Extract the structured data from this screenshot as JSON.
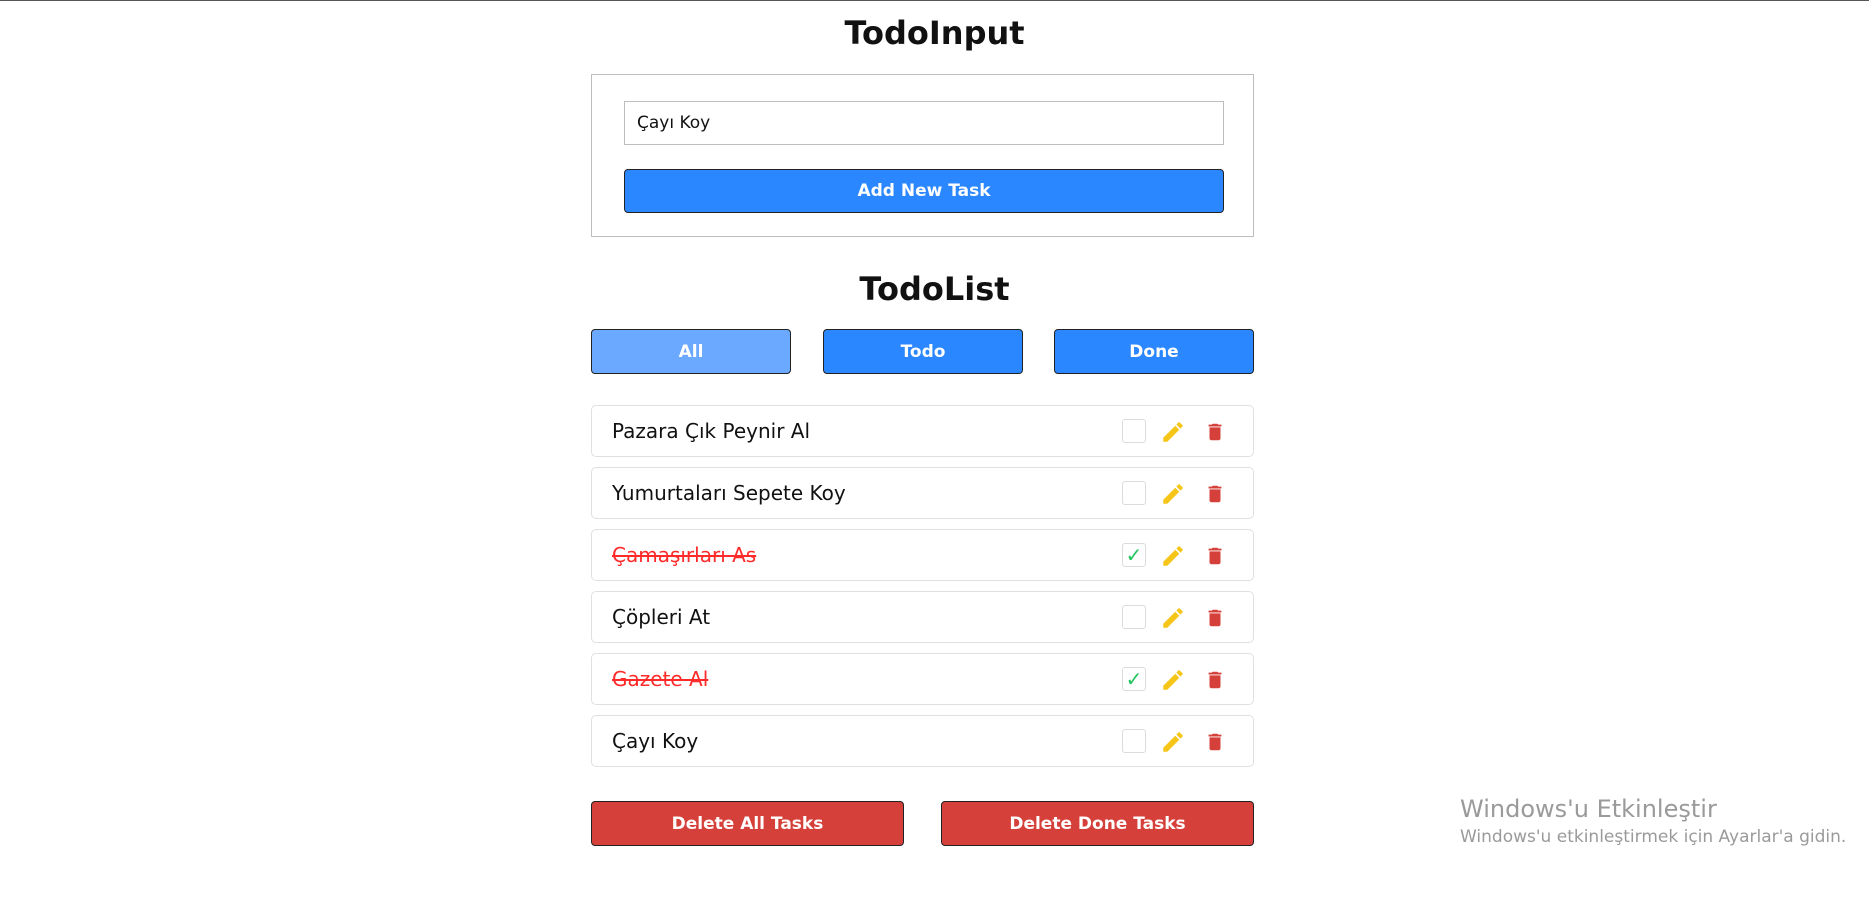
{
  "input_section": {
    "title": "TodoInput",
    "input_value": "Çayı Koy",
    "add_button_label": "Add New Task"
  },
  "list_section": {
    "title": "TodoList",
    "filters": [
      {
        "label": "All",
        "active": true
      },
      {
        "label": "Todo",
        "active": false
      },
      {
        "label": "Done",
        "active": false
      }
    ],
    "tasks": [
      {
        "text": "Pazara Çık Peynir Al",
        "done": false
      },
      {
        "text": "Yumurtaları Sepete Koy",
        "done": false
      },
      {
        "text": "Çamaşırları As",
        "done": true
      },
      {
        "text": "Çöpleri At",
        "done": false
      },
      {
        "text": "Gazete Al",
        "done": true
      },
      {
        "text": "Çayı Koy",
        "done": false
      }
    ],
    "delete_all_label": "Delete All Tasks",
    "delete_done_label": "Delete Done Tasks"
  },
  "icons": {
    "edit": "pencil-icon",
    "delete": "trash-icon",
    "check": "checkmark-icon"
  },
  "colors": {
    "primary": "#2b87ff",
    "primary_active": "#6aa9ff",
    "danger": "#d6403a",
    "edit_icon": "#f5c518",
    "done_text": "#ff2a2a",
    "check": "#22c55e"
  },
  "watermark": {
    "title": "Windows'u Etkinleştir",
    "subtitle": "Windows'u etkinleştirmek için Ayarlar'a gidin."
  }
}
